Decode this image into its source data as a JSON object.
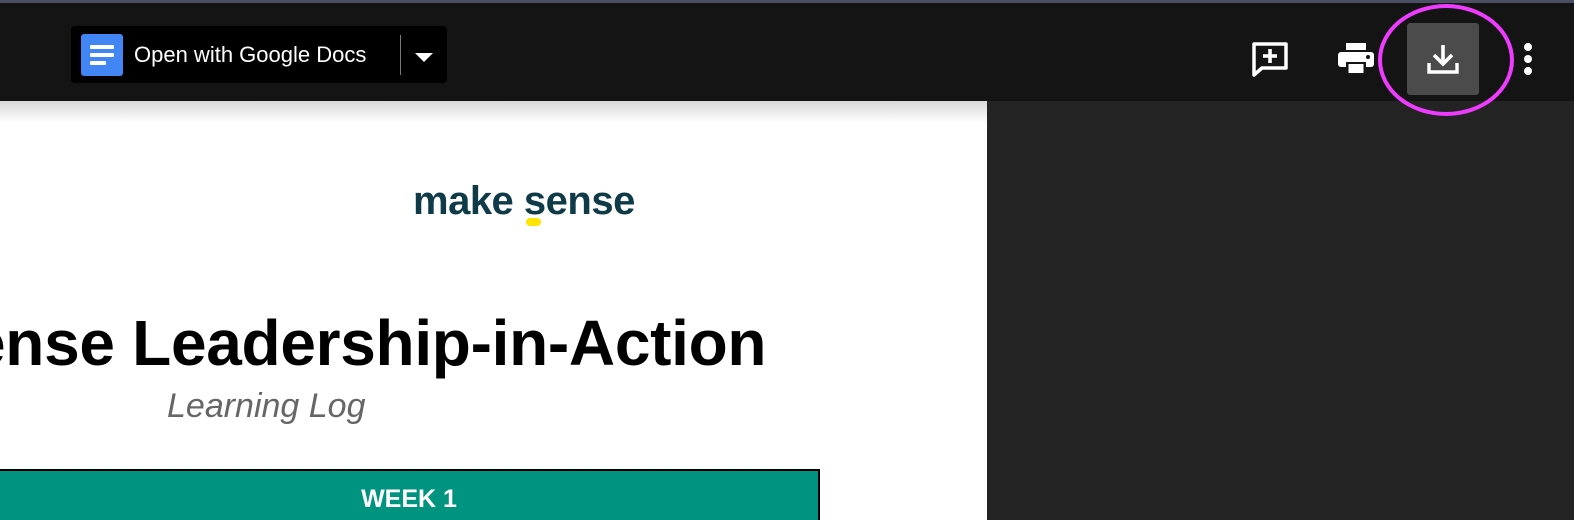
{
  "toolbar": {
    "open_with_label": "Open with Google Docs",
    "icons": {
      "docs": "google-docs-icon",
      "caret": "caret-down-icon",
      "comment": "add-comment-icon",
      "print": "print-icon",
      "download": "download-icon",
      "more": "more-vert-icon"
    }
  },
  "document": {
    "logo_text": "make sense",
    "title": "ense Leadership-in-Action",
    "subtitle": "Learning Log",
    "week_header": "WEEK 1"
  },
  "colors": {
    "toolbar_bg": "#141414",
    "page_bg": "#232323",
    "docs_blue": "#4285f4",
    "download_bg": "#4b4b4b",
    "highlight_ring": "#ee3cff",
    "logo_text": "#0f3b48",
    "logo_accent": "#ffe400",
    "week_header_bg": "#009480"
  }
}
